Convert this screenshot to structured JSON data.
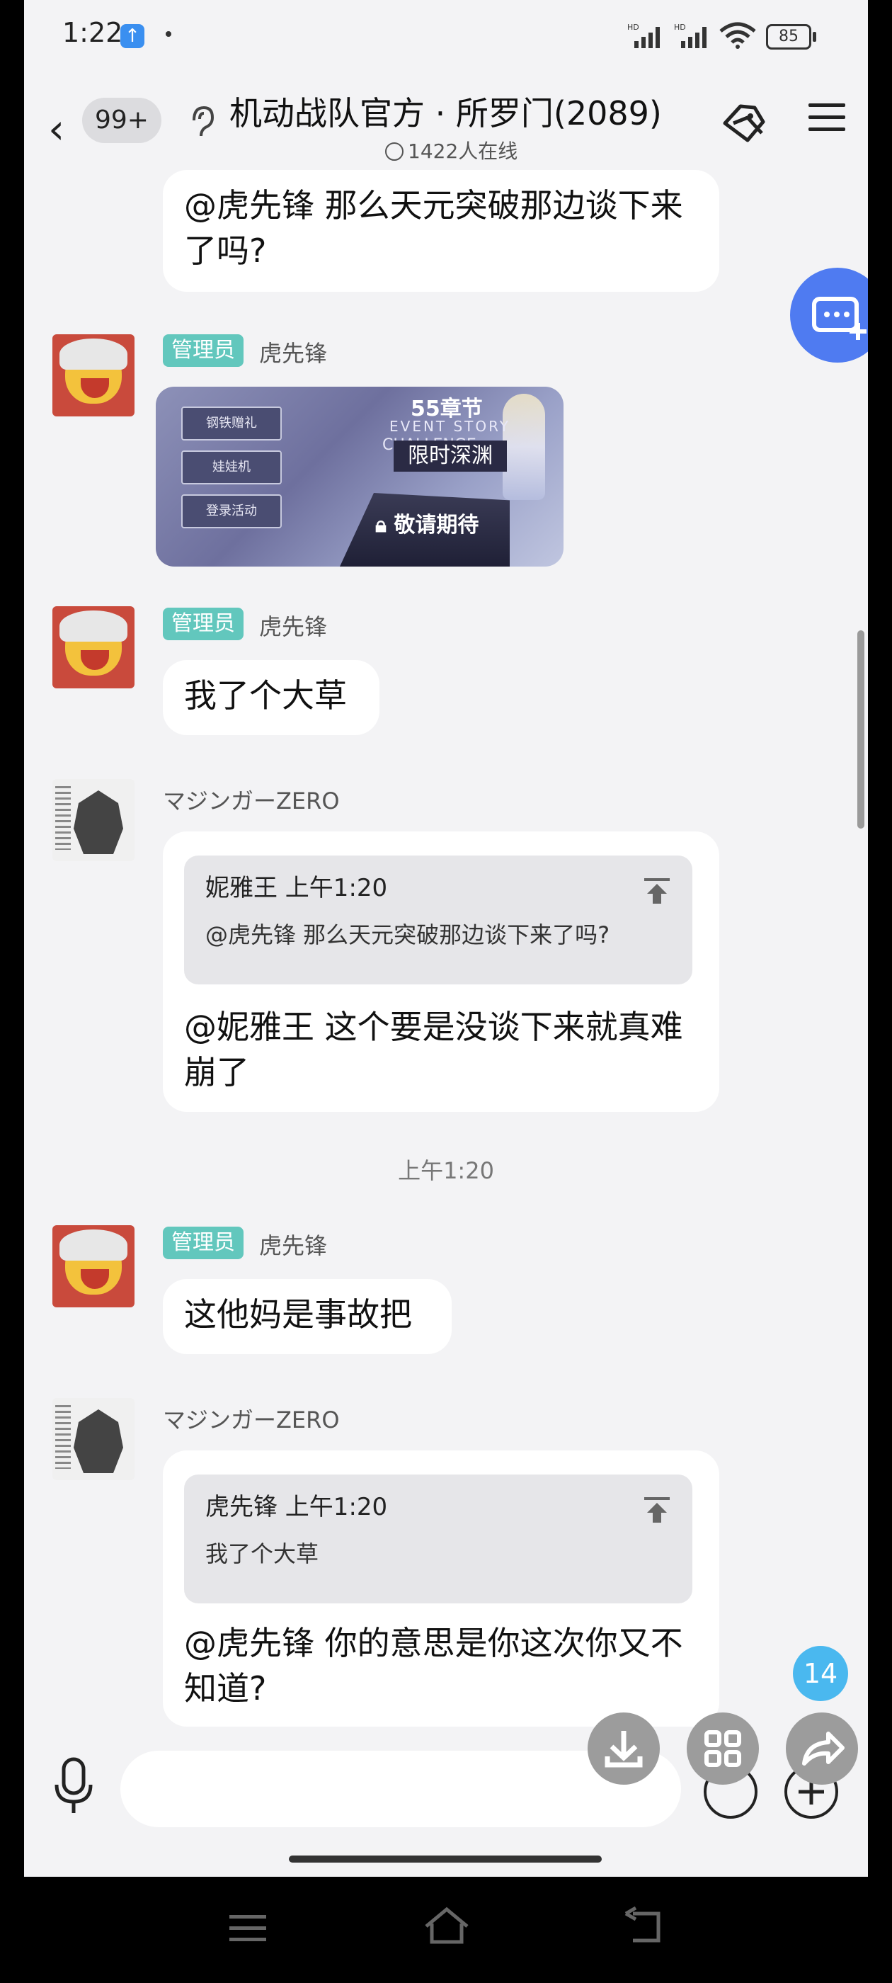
{
  "status_bar": {
    "time": "1:22",
    "battery": "85"
  },
  "header": {
    "unread": "99+",
    "title": "机动战队官方 · 所罗门(2089)",
    "online": "1422人在线"
  },
  "messages": {
    "m0": {
      "text": "@虎先锋 那么天元突破那边谈下来了吗?"
    },
    "m1": {
      "role": "管理员",
      "sender": "虎先锋",
      "image": {
        "buttons": [
          "钢铁赠礼",
          "娃娃机",
          "登录活动"
        ],
        "chapter": "55章节",
        "event": "EVENT STORY",
        "challenge": "CHALLENGE",
        "abyss": "限时深渊",
        "lock": "敬请期待"
      }
    },
    "m2": {
      "role": "管理员",
      "sender": "虎先锋",
      "text": "我了个大草"
    },
    "m3": {
      "sender": "マジンガーZERO",
      "quote_head": "妮雅王 上午1:20",
      "quote_text": "@虎先锋 那么天元突破那边谈下来了吗?",
      "text": "@妮雅王 这个要是没谈下来就真难崩了"
    },
    "time_sep": "上午1:20",
    "m4": {
      "role": "管理员",
      "sender": "虎先锋",
      "text": "这他妈是事故把"
    },
    "m5": {
      "sender": "マジンガーZERO",
      "quote_head": "虎先锋 上午1:20",
      "quote_text": "我了个大草",
      "text": "@虎先锋 你的意思是你这次你又不知道?"
    }
  },
  "floating": {
    "new_count": "14"
  },
  "colors": {
    "accent": "#4f7bf1",
    "admin_badge": "#62c7bd",
    "count_badge": "#4ab8ef"
  }
}
